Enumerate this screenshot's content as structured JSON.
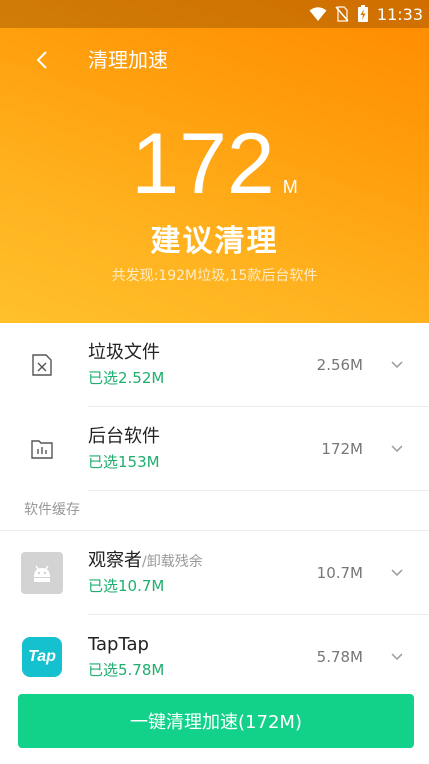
{
  "status_bar": {
    "time": "11:33"
  },
  "header": {
    "title": "清理加速"
  },
  "summary": {
    "amount": "172",
    "unit": "M",
    "advice": "建议清理",
    "found_text": "共发现:192M垃圾,15款后台软件"
  },
  "items": [
    {
      "name": "垃圾文件",
      "selected": "已选2.52M",
      "size": "2.56M",
      "icon": "trash-file-icon"
    },
    {
      "name": "后台软件",
      "selected": "已选153M",
      "size": "172M",
      "icon": "folder-chart-icon"
    }
  ],
  "section_label": "软件缓存",
  "cache_items": [
    {
      "name": "观察者",
      "suffix": "/卸载残余",
      "selected": "已选10.7M",
      "size": "10.7M",
      "icon": "android-app-icon"
    },
    {
      "name": "TapTap",
      "suffix": "",
      "selected": "已选5.78M",
      "size": "5.78M",
      "icon": "taptap-app-icon",
      "icon_text": "Tap"
    }
  ],
  "action_button": {
    "label": "一键清理加速(172M)"
  },
  "colors": {
    "accent_green": "#12d28a",
    "selected_text": "#1fae6e",
    "hero_orange": "#ff9d0c",
    "taptap_teal": "#16c1cf"
  }
}
